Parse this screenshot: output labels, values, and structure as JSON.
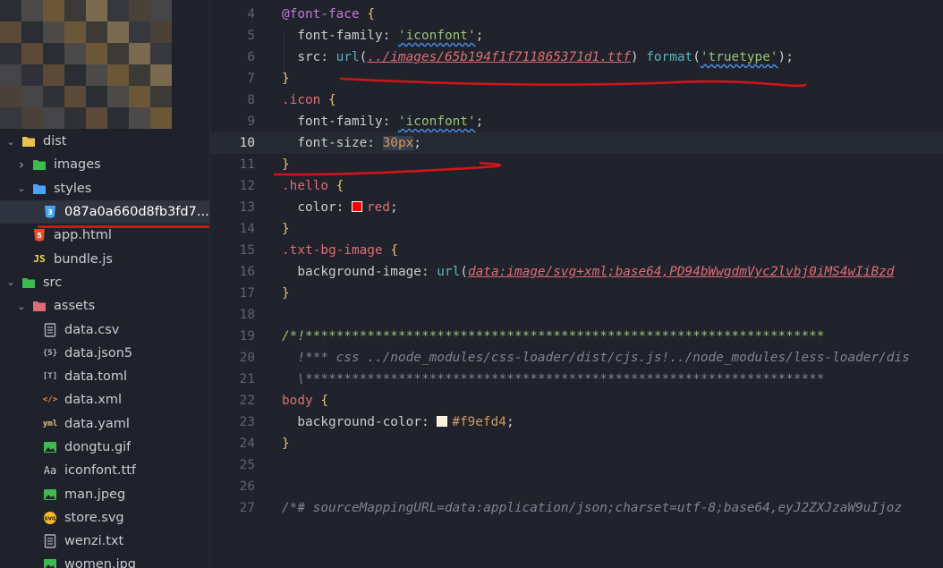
{
  "sidebar": {
    "items": [
      {
        "label": "dist",
        "chevron": "down",
        "icon": "folder-dist-icon",
        "icon_color": "#e8c150",
        "indent": 0,
        "selected": false
      },
      {
        "label": "images",
        "chevron": "right",
        "icon": "folder-images-icon",
        "icon_color": "#3fb950",
        "indent": 1,
        "selected": false
      },
      {
        "label": "styles",
        "chevron": "down",
        "icon": "folder-styles-icon",
        "icon_color": "#4aa3ff",
        "indent": 1,
        "selected": false
      },
      {
        "label": "087a0a660d8fb3fd7...",
        "chevron": "",
        "icon": "css-file-icon",
        "icon_color": "#42a5f5",
        "icon_text": "3",
        "indent": 2,
        "selected": true
      },
      {
        "label": "app.html",
        "chevron": "",
        "icon": "html-file-icon",
        "icon_color": "#e44d26",
        "icon_text": "5",
        "indent": 1,
        "selected": false
      },
      {
        "label": "bundle.js",
        "chevron": "",
        "icon": "js-file-icon",
        "icon_color": "#f5d94c",
        "icon_text": "JS",
        "indent": 1,
        "selected": false
      },
      {
        "label": "src",
        "chevron": "down",
        "icon": "folder-src-icon",
        "icon_color": "#3fb950",
        "indent": 0,
        "selected": false
      },
      {
        "label": "assets",
        "chevron": "down",
        "icon": "folder-assets-icon",
        "icon_color": "#e06c75",
        "indent": 1,
        "selected": false
      },
      {
        "label": "data.csv",
        "chevron": "",
        "icon": "file-lines-icon",
        "icon_color": "#aab2bf",
        "indent": 2,
        "selected": false
      },
      {
        "label": "data.json5",
        "chevron": "",
        "icon": "json-file-icon",
        "icon_color": "#aab2bf",
        "icon_text": "{5}",
        "indent": 2,
        "selected": false
      },
      {
        "label": "data.toml",
        "chevron": "",
        "icon": "toml-file-icon",
        "icon_color": "#aab2bf",
        "icon_text": "[T]",
        "indent": 2,
        "selected": false
      },
      {
        "label": "data.xml",
        "chevron": "",
        "icon": "xml-file-icon",
        "icon_color": "#f08d49",
        "icon_text": "</>",
        "indent": 2,
        "selected": false
      },
      {
        "label": "data.yaml",
        "chevron": "",
        "icon": "yaml-file-icon",
        "icon_color": "#e5c07b",
        "icon_text": "yml",
        "indent": 2,
        "selected": false
      },
      {
        "label": "dongtu.gif",
        "chevron": "",
        "icon": "image-file-icon",
        "icon_color": "#3fb950",
        "indent": 2,
        "selected": false
      },
      {
        "label": "iconfont.ttf",
        "chevron": "",
        "icon": "font-file-icon",
        "icon_color": "#c8ccd4",
        "icon_text": "Aa",
        "indent": 2,
        "selected": false
      },
      {
        "label": "man.jpeg",
        "chevron": "",
        "icon": "image-file-icon",
        "icon_color": "#3fb950",
        "indent": 2,
        "selected": false
      },
      {
        "label": "store.svg",
        "chevron": "",
        "icon": "svg-file-icon",
        "icon_color": "#f5b82e",
        "icon_text": "SVG",
        "indent": 2,
        "selected": false
      },
      {
        "label": "wenzi.txt",
        "chevron": "",
        "icon": "file-lines-icon",
        "icon_color": "#aab2bf",
        "indent": 2,
        "selected": false
      },
      {
        "label": "women.jpg",
        "chevron": "",
        "icon": "image-file-icon",
        "icon_color": "#3fb950",
        "indent": 2,
        "selected": false
      }
    ]
  },
  "editor": {
    "current_line": 10,
    "lines": [
      {
        "n": "4",
        "tokens": [
          [
            "t-at",
            "@font-face"
          ],
          [
            "t-punct",
            " "
          ],
          [
            "t-brace",
            "{"
          ]
        ]
      },
      {
        "n": "5",
        "tokens": [
          [
            "t-prop",
            "  font-family: "
          ],
          [
            "t-str squig",
            "'iconfont'"
          ],
          [
            "t-punct",
            ";"
          ]
        ]
      },
      {
        "n": "6",
        "tokens": [
          [
            "t-prop",
            "  src: "
          ],
          [
            "t-fn",
            "url"
          ],
          [
            "t-punct",
            "("
          ],
          [
            "t-url",
            "../images/65b194f1f711865371d1.ttf"
          ],
          [
            "t-punct",
            ") "
          ],
          [
            "t-fn",
            "format"
          ],
          [
            "t-punct",
            "("
          ],
          [
            "t-str squig",
            "'truetype'"
          ],
          [
            "t-punct",
            ");"
          ]
        ]
      },
      {
        "n": "7",
        "tokens": [
          [
            "t-brace",
            "}"
          ]
        ]
      },
      {
        "n": "8",
        "tokens": [
          [
            "t-sel",
            ".icon"
          ],
          [
            "t-punct",
            " "
          ],
          [
            "t-brace",
            "{"
          ]
        ]
      },
      {
        "n": "9",
        "tokens": [
          [
            "t-prop",
            "  font-family: "
          ],
          [
            "t-str squig",
            "'iconfont'"
          ],
          [
            "t-punct",
            ";"
          ]
        ]
      },
      {
        "n": "10",
        "tokens": [
          [
            "t-prop",
            "  font-size: "
          ],
          [
            "t-num hl",
            "30px"
          ],
          [
            "t-punct",
            ";"
          ]
        ]
      },
      {
        "n": "11",
        "tokens": [
          [
            "t-brace",
            "}"
          ]
        ]
      },
      {
        "n": "12",
        "tokens": [
          [
            "t-sel",
            ".hello"
          ],
          [
            "t-punct",
            " "
          ],
          [
            "t-brace",
            "{"
          ]
        ]
      },
      {
        "n": "13",
        "tokens": [
          [
            "t-prop",
            "  color: "
          ],
          [
            "swatch",
            "#ff0000"
          ],
          [
            "t-sel",
            "red"
          ],
          [
            "t-punct",
            ";"
          ]
        ]
      },
      {
        "n": "14",
        "tokens": [
          [
            "t-brace",
            "}"
          ]
        ]
      },
      {
        "n": "15",
        "tokens": [
          [
            "t-sel",
            ".txt-bg-image"
          ],
          [
            "t-punct",
            " "
          ],
          [
            "t-brace",
            "{"
          ]
        ]
      },
      {
        "n": "16",
        "tokens": [
          [
            "t-prop",
            "  background-image: "
          ],
          [
            "t-fn",
            "url"
          ],
          [
            "t-punct",
            "("
          ],
          [
            "t-url",
            "data:image/svg+xml;base64,PD94bWwgdmVyc2lvbj0iMS4wIiBzd"
          ]
        ]
      },
      {
        "n": "17",
        "tokens": [
          [
            "t-brace",
            "}"
          ]
        ]
      },
      {
        "n": "18",
        "tokens": []
      },
      {
        "n": "19",
        "tokens": [
          [
            "t-commg",
            "/*!*******************************************************************"
          ]
        ]
      },
      {
        "n": "20",
        "tokens": [
          [
            "t-comm",
            "  !*** css ../node_modules/css-loader/dist/cjs.js!../node_modules/less-loader/dis"
          ]
        ]
      },
      {
        "n": "21",
        "tokens": [
          [
            "t-comm",
            "  \\*******************************************************************"
          ]
        ]
      },
      {
        "n": "22",
        "tokens": [
          [
            "t-sel",
            "body"
          ],
          [
            "t-punct",
            " "
          ],
          [
            "t-brace",
            "{"
          ]
        ]
      },
      {
        "n": "23",
        "tokens": [
          [
            "t-prop",
            "  background-color: "
          ],
          [
            "swatch",
            "#f9efd4"
          ],
          [
            "t-num",
            "#f9efd4"
          ],
          [
            "t-punct",
            ";"
          ]
        ]
      },
      {
        "n": "24",
        "tokens": [
          [
            "t-brace",
            "}"
          ]
        ]
      },
      {
        "n": "25",
        "tokens": []
      },
      {
        "n": "26",
        "tokens": []
      },
      {
        "n": "27",
        "tokens": [
          [
            "t-comm",
            "/*# sourceMappingURL=data:application/json;charset=utf-8;base64,eyJ2ZXJzaW9uIjoz"
          ]
        ]
      }
    ]
  },
  "colors": {
    "annotation_red": "#d4141a",
    "editor_bg": "#20232b",
    "sidebar_bg": "#1f222a"
  }
}
